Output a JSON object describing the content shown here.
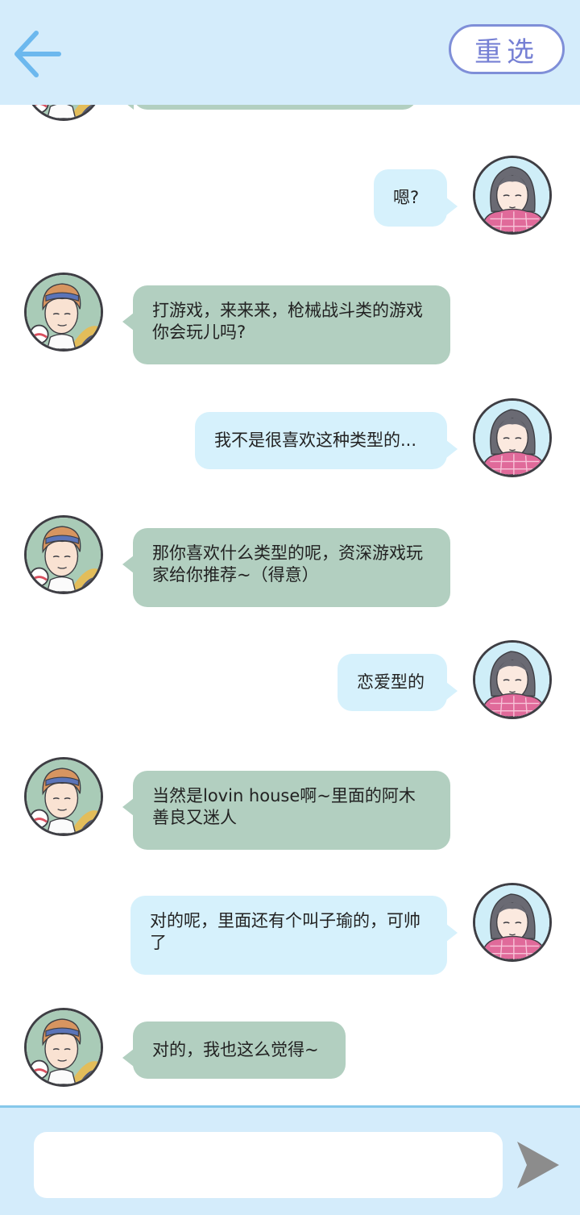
{
  "header": {
    "reselect_label": "重选"
  },
  "icons": {
    "back": "arrow-left-icon",
    "send": "send-icon"
  },
  "colors": {
    "header_bg": "#d4ecfb",
    "back_arrow": "#6cb8ee",
    "reselect_border": "#7f8fd8",
    "boy_bubble": "#b2cfc0",
    "girl_bubble": "#d6f1fc",
    "send_icon": "#8c8c8c"
  },
  "messages": [
    {
      "sender": "boy",
      "text": ""
    },
    {
      "sender": "girl",
      "text": "嗯?"
    },
    {
      "sender": "boy",
      "text": "打游戏，来来来，枪械战斗类的游戏你会玩儿吗?"
    },
    {
      "sender": "girl",
      "text": "我不是很喜欢这种类型的..."
    },
    {
      "sender": "boy",
      "text": "那你喜欢什么类型的呢，资深游戏玩家给你推荐~（得意）"
    },
    {
      "sender": "girl",
      "text": "恋爱型的"
    },
    {
      "sender": "boy",
      "text": "当然是lovin house啊~里面的阿木善良又迷人"
    },
    {
      "sender": "girl",
      "text": "对的呢，里面还有个叫子瑜的，可帅了"
    },
    {
      "sender": "boy",
      "text": "对的，我也这么觉得~"
    }
  ],
  "composer": {
    "value": "",
    "placeholder": ""
  }
}
